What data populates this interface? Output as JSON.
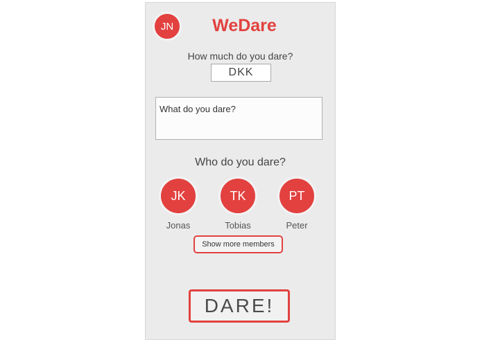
{
  "header": {
    "user_initials": "JN",
    "title": "WeDare"
  },
  "amount": {
    "question": "How much do you dare?",
    "currency": "DKK"
  },
  "dare": {
    "placeholder": "What do you dare?"
  },
  "members": {
    "question": "Who do you dare?",
    "items": [
      {
        "initials": "JK",
        "name": "Jonas"
      },
      {
        "initials": "TK",
        "name": "Tobias"
      },
      {
        "initials": "PT",
        "name": "Peter"
      }
    ],
    "show_more_label": "Show more members"
  },
  "submit": {
    "label": "DARE!"
  },
  "colors": {
    "accent": "#e2413f",
    "panel": "#ebebeb"
  }
}
